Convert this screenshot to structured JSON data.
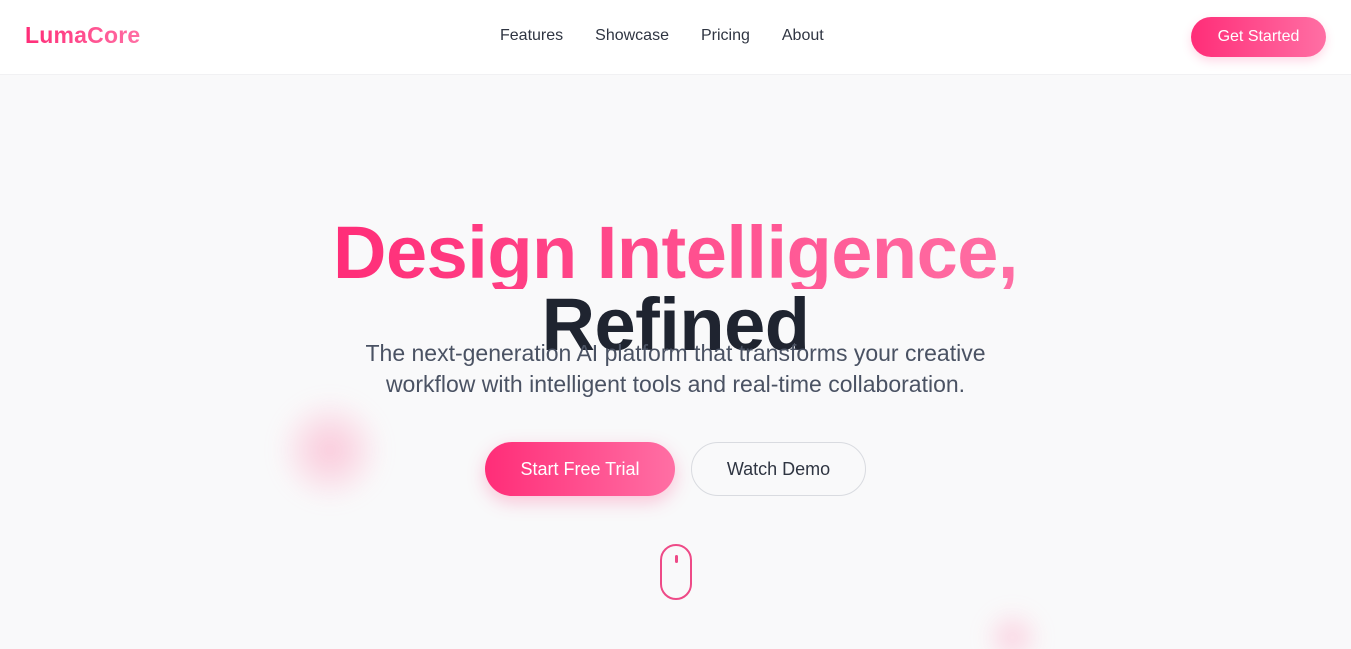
{
  "brand": {
    "name": "LumaCore"
  },
  "nav": {
    "items": [
      {
        "label": "Features"
      },
      {
        "label": "Showcase"
      },
      {
        "label": "Pricing"
      },
      {
        "label": "About"
      }
    ],
    "cta_label": "Get Started"
  },
  "hero": {
    "headline_gradient": "Design Intelligence,",
    "headline_dark": "Refined",
    "subtitle_line1": "The next-generation AI platform that transforms your creative",
    "subtitle_line2": "workflow with intelligent tools and real-time collaboration.",
    "primary_cta": "Start Free Trial",
    "secondary_cta": "Watch Demo"
  },
  "colors": {
    "accent_start": "#ff2d78",
    "accent_end": "#ff6fa4",
    "text_dark": "#1f2430",
    "text_muted": "#4a5263",
    "background": "#f9f9fa"
  },
  "icons": {
    "scroll": "mouse-scroll-icon"
  }
}
